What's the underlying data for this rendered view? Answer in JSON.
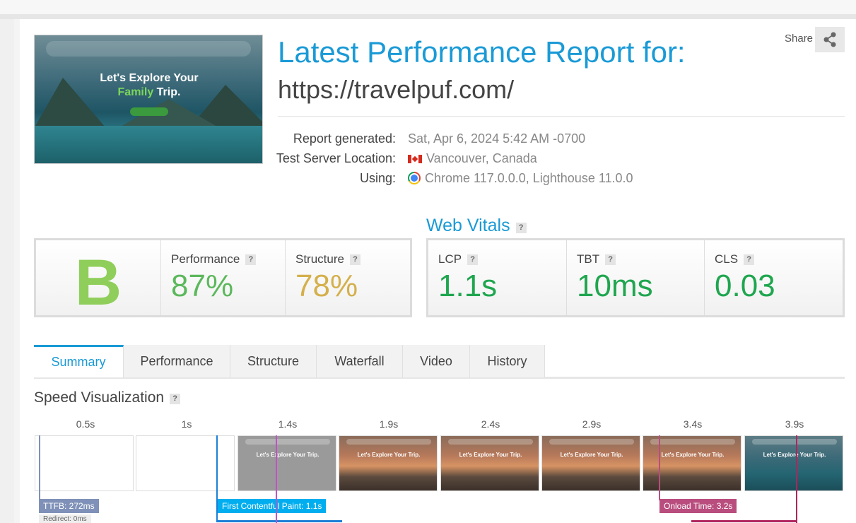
{
  "report": {
    "title": "Latest Performance Report for:",
    "url": "https://travelpuf.com/",
    "share_label": "Share"
  },
  "thumbnail": {
    "headline_line1": "Let's Explore Your",
    "headline_line2_highlight": "Family",
    "headline_line2_rest": " Trip."
  },
  "meta": [
    {
      "label": "Report generated:",
      "value": "Sat, Apr 6, 2024 5:42 AM -0700",
      "icon": ""
    },
    {
      "label": "Test Server Location:",
      "value": "Vancouver, Canada",
      "icon": "canada-flag-icon"
    },
    {
      "label": "Using:",
      "value": "Chrome 117.0.0.0, Lighthouse 11.0.0",
      "icon": "chrome-icon"
    }
  ],
  "grades": {
    "grade": "B",
    "performance_label": "Performance",
    "performance_value": "87%",
    "structure_label": "Structure",
    "structure_value": "78%"
  },
  "web_vitals": {
    "title": "Web Vitals",
    "lcp_label": "LCP",
    "lcp_value": "1.1s",
    "tbt_label": "TBT",
    "tbt_value": "10ms",
    "cls_label": "CLS",
    "cls_value": "0.03"
  },
  "tabs": [
    {
      "label": "Summary",
      "active": true
    },
    {
      "label": "Performance",
      "active": false
    },
    {
      "label": "Structure",
      "active": false
    },
    {
      "label": "Waterfall",
      "active": false
    },
    {
      "label": "Video",
      "active": false
    },
    {
      "label": "History",
      "active": false
    }
  ],
  "speed": {
    "title": "Speed Visualization",
    "ticks": [
      "0.5s",
      "1s",
      "1.4s",
      "1.9s",
      "2.4s",
      "2.9s",
      "3.4s",
      "3.9s"
    ],
    "frame_headline": "Let's Explore Your Trip.",
    "markers": {
      "ttfb": "TTFB: 272ms",
      "redirect": "Redirect: 0ms",
      "fcp": "First Contentful Paint: 1.1s",
      "onload": "Onload Time: 3.2s"
    }
  },
  "colors": {
    "accent": "#1a9ad6",
    "grade_green": "#8fce5a",
    "performance_green": "#5cb85c",
    "structure_gold": "#d4b04c",
    "vital_green": "#1fa64f",
    "ttfb": "#7f91b8",
    "fcp": "#00aeef",
    "lcp_line": "#c251c9",
    "onload": "#b94d7e"
  }
}
